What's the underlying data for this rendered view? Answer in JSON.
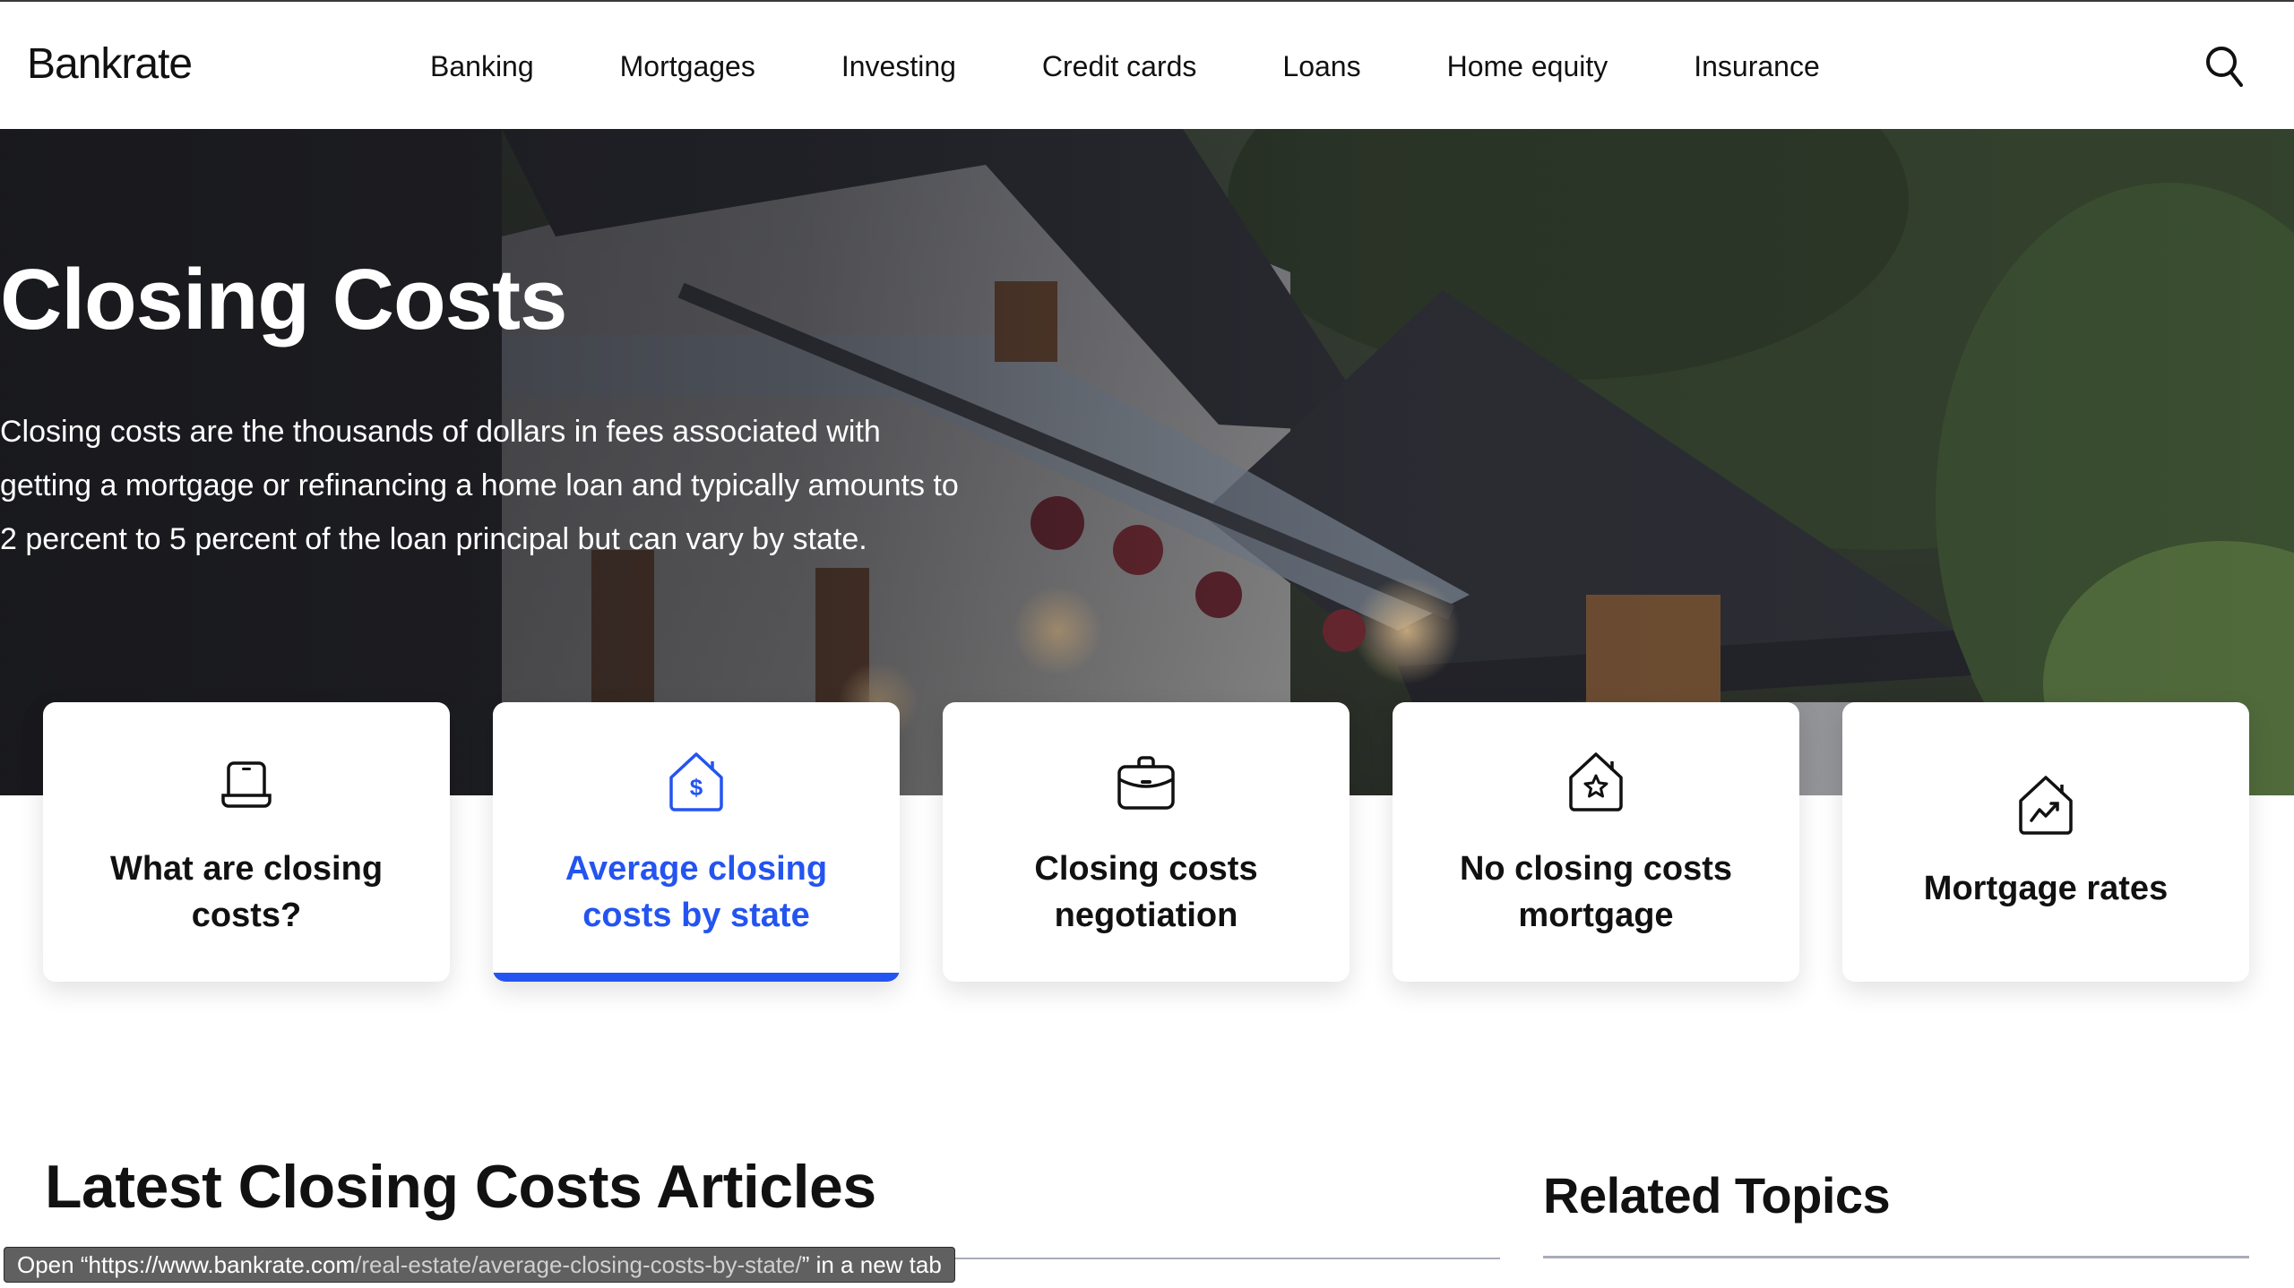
{
  "header": {
    "logo": "Bankrate",
    "nav": [
      "Banking",
      "Mortgages",
      "Investing",
      "Credit cards",
      "Loans",
      "Home equity",
      "Insurance"
    ],
    "search_icon": "search-icon"
  },
  "hero": {
    "title": "Closing Costs",
    "description": "Closing costs are the thousands of dollars in fees associated with getting a mortgage or refinancing a home loan and typically amounts to 2 percent to 5 percent of the loan principal but can vary by state.",
    "background": "house-photo"
  },
  "cards": [
    {
      "label": "What are closing costs?",
      "icon": "laptop-icon",
      "active": false
    },
    {
      "label": "Average closing costs by state",
      "icon": "house-dollar-icon",
      "active": true
    },
    {
      "label": "Closing costs negotiation",
      "icon": "briefcase-icon",
      "active": false
    },
    {
      "label": "No closing costs mortgage",
      "icon": "house-star-icon",
      "active": false
    },
    {
      "label": "Mortgage rates",
      "icon": "house-chart-icon",
      "active": false
    }
  ],
  "sections": {
    "latest_title": "Latest Closing Costs Articles",
    "related_title": "Related Topics"
  },
  "status_bar": {
    "prefix": "Open “https://www.bankrate.com",
    "path": "/real-estate/average-closing-costs-by-state/",
    "suffix": "” in a new tab"
  },
  "colors": {
    "accent": "#2454f0",
    "text": "#111111",
    "rule": "#a9adb9"
  }
}
